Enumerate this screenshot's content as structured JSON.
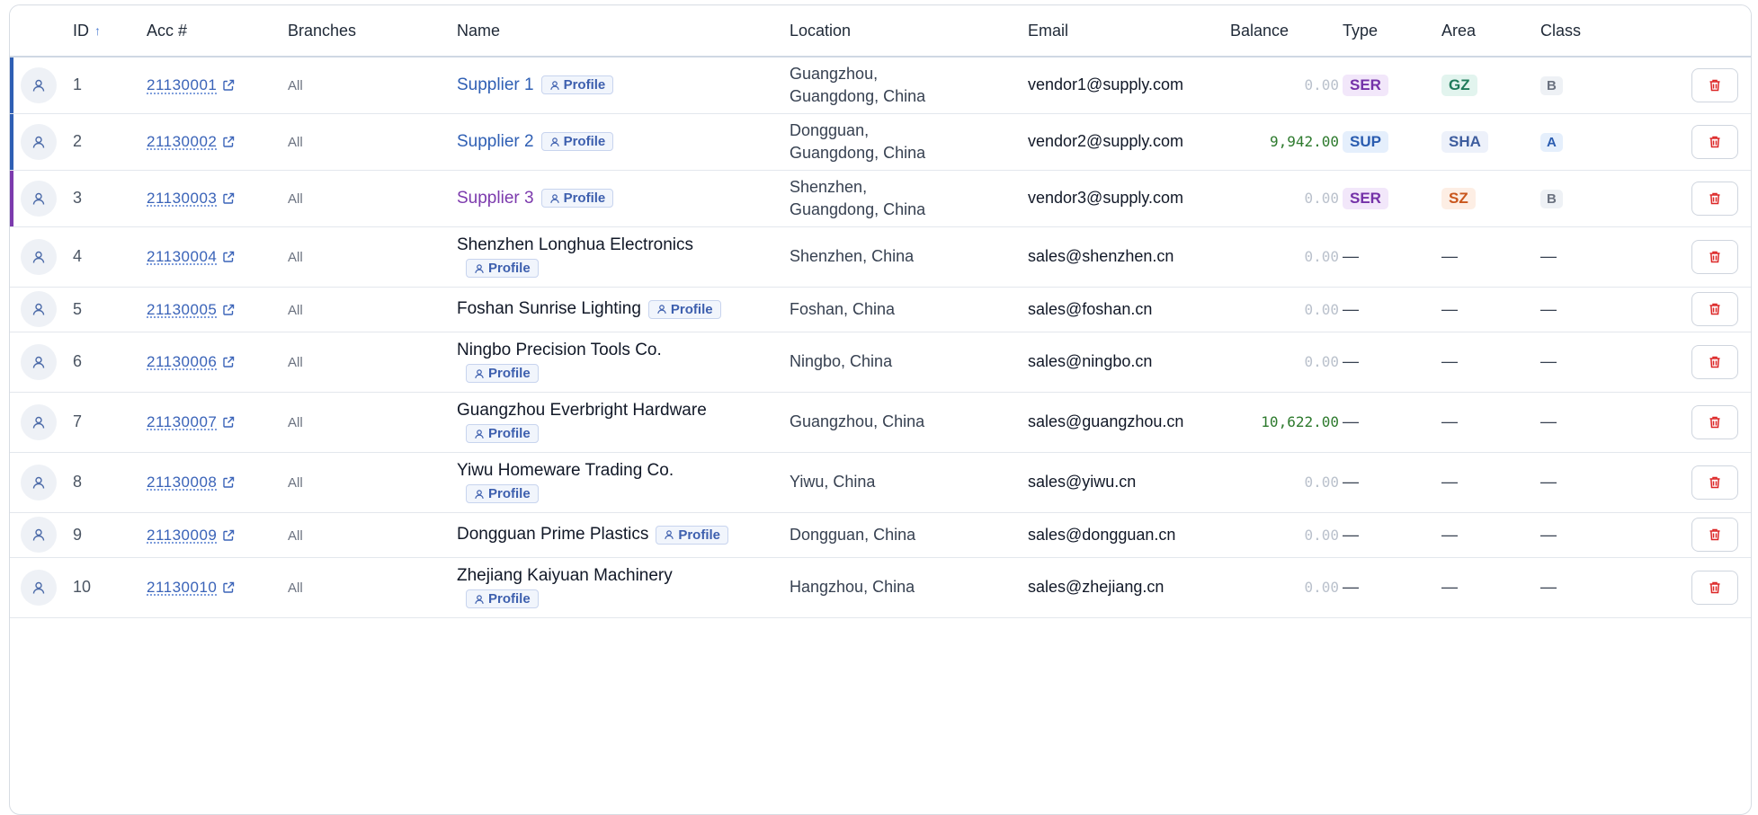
{
  "columns": {
    "id": "ID",
    "acc": "Acc #",
    "branches": "Branches",
    "name": "Name",
    "location": "Location",
    "email": "Email",
    "balance": "Balance",
    "type": "Type",
    "area": "Area",
    "class": "Class"
  },
  "sort": {
    "column": "ID",
    "direction": "ascending",
    "icon": "arrow-up-icon"
  },
  "profile_label": "Profile",
  "dash": "—",
  "colors": {
    "accent_blue": "#2f5fb4",
    "accent_purple": "#7c3aad",
    "positive": "#2d7a2d",
    "danger": "#dc2626"
  },
  "rows": [
    {
      "id": "1",
      "acc": "21130001",
      "branches": "All",
      "name": "Supplier 1",
      "name_color": "blue",
      "accent": "blue",
      "location": "Guangzhou, Guangdong, China",
      "email": "vendor1@supply.com",
      "balance": "0.00",
      "balance_state": "zero",
      "type": "SER",
      "area": "GZ",
      "class": "B",
      "stack": false
    },
    {
      "id": "2",
      "acc": "21130002",
      "branches": "All",
      "name": "Supplier 2",
      "name_color": "blue",
      "accent": "blue",
      "location": "Dongguan, Guangdong, China",
      "email": "vendor2@supply.com",
      "balance": "9,942.00",
      "balance_state": "pos",
      "type": "SUP",
      "area": "SHA",
      "class": "A",
      "stack": false
    },
    {
      "id": "3",
      "acc": "21130003",
      "branches": "All",
      "name": "Supplier 3",
      "name_color": "purple",
      "accent": "purple",
      "location": "Shenzhen, Guangdong, China",
      "email": "vendor3@supply.com",
      "balance": "0.00",
      "balance_state": "zero",
      "type": "SER",
      "area": "SZ",
      "class": "B",
      "stack": false
    },
    {
      "id": "4",
      "acc": "21130004",
      "branches": "All",
      "name": "Shenzhen Longhua Electronics",
      "name_color": "default",
      "accent": "",
      "location": "Shenzhen, China",
      "email": "sales@shenzhen.cn",
      "balance": "0.00",
      "balance_state": "zero",
      "type": "",
      "area": "",
      "class": "",
      "stack": true
    },
    {
      "id": "5",
      "acc": "21130005",
      "branches": "All",
      "name": "Foshan Sunrise Lighting",
      "name_color": "default",
      "accent": "",
      "location": "Foshan, China",
      "email": "sales@foshan.cn",
      "balance": "0.00",
      "balance_state": "zero",
      "type": "",
      "area": "",
      "class": "",
      "stack": false
    },
    {
      "id": "6",
      "acc": "21130006",
      "branches": "All",
      "name": "Ningbo Precision Tools Co.",
      "name_color": "default",
      "accent": "",
      "location": "Ningbo, China",
      "email": "sales@ningbo.cn",
      "balance": "0.00",
      "balance_state": "zero",
      "type": "",
      "area": "",
      "class": "",
      "stack": true
    },
    {
      "id": "7",
      "acc": "21130007",
      "branches": "All",
      "name": "Guangzhou Everbright Hardware",
      "name_color": "default",
      "accent": "",
      "location": "Guangzhou, China",
      "email": "sales@guangzhou.cn",
      "balance": "10,622.00",
      "balance_state": "pos",
      "type": "",
      "area": "",
      "class": "",
      "stack": true
    },
    {
      "id": "8",
      "acc": "21130008",
      "branches": "All",
      "name": "Yiwu Homeware Trading Co.",
      "name_color": "default",
      "accent": "",
      "location": "Yiwu, China",
      "email": "sales@yiwu.cn",
      "balance": "0.00",
      "balance_state": "zero",
      "type": "",
      "area": "",
      "class": "",
      "stack": true
    },
    {
      "id": "9",
      "acc": "21130009",
      "branches": "All",
      "name": "Dongguan Prime Plastics",
      "name_color": "default",
      "accent": "",
      "location": "Dongguan, China",
      "email": "sales@dongguan.cn",
      "balance": "0.00",
      "balance_state": "zero",
      "type": "",
      "area": "",
      "class": "",
      "stack": false
    },
    {
      "id": "10",
      "acc": "21130010",
      "branches": "All",
      "name": "Zhejiang Kaiyuan Machinery",
      "name_color": "default",
      "accent": "",
      "location": "Hangzhou, China",
      "email": "sales@zhejiang.cn",
      "balance": "0.00",
      "balance_state": "zero",
      "type": "",
      "area": "",
      "class": "",
      "stack": true
    }
  ]
}
